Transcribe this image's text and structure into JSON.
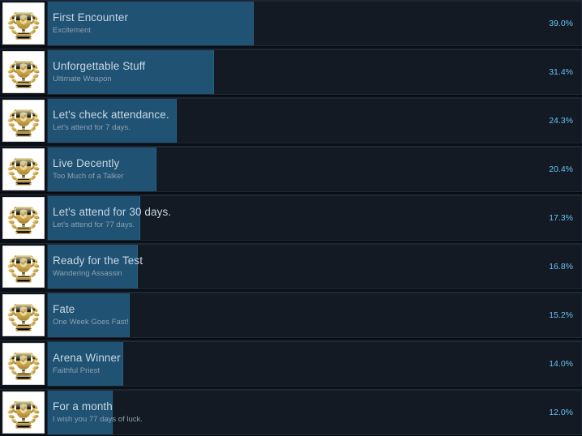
{
  "icon": {
    "name": "trophy-icon",
    "alt": "gold trophy with laurel wreath"
  },
  "colors": {
    "page_background": "#0c1117",
    "row_background": "#0f1620",
    "track": "#131a23",
    "fill": "#1f5273",
    "title_text": "#c9d7e2",
    "description_text": "#8fa1b0",
    "percent_text": "#67c1f5"
  },
  "achievements": [
    {
      "title": "First Encounter",
      "description": "Excitement",
      "percent_label": "39.0%",
      "percent_value": 39.0
    },
    {
      "title": "Unforgettable Stuff",
      "description": "Ultimate Weapon",
      "percent_label": "31.4%",
      "percent_value": 31.4
    },
    {
      "title": "Let's check attendance.",
      "description": "Let's attend for 7 days.",
      "percent_label": "24.3%",
      "percent_value": 24.3
    },
    {
      "title": "Live Decently",
      "description": "Too Much of a Talker",
      "percent_label": "20.4%",
      "percent_value": 20.4
    },
    {
      "title": "Let's attend for 30 days.",
      "description": "Let's attend for 77 days.",
      "percent_label": "17.3%",
      "percent_value": 17.3
    },
    {
      "title": "Ready for the Test",
      "description": "Wandering Assassin",
      "percent_label": "16.8%",
      "percent_value": 16.8
    },
    {
      "title": "Fate",
      "description": "One Week Goes Fast!",
      "percent_label": "15.2%",
      "percent_value": 15.2
    },
    {
      "title": "Arena Winner",
      "description": "Faithful Priest",
      "percent_label": "14.0%",
      "percent_value": 14.0
    },
    {
      "title": "For a month",
      "description": "I wish you 77 days of luck.",
      "percent_label": "12.0%",
      "percent_value": 12.0
    }
  ]
}
